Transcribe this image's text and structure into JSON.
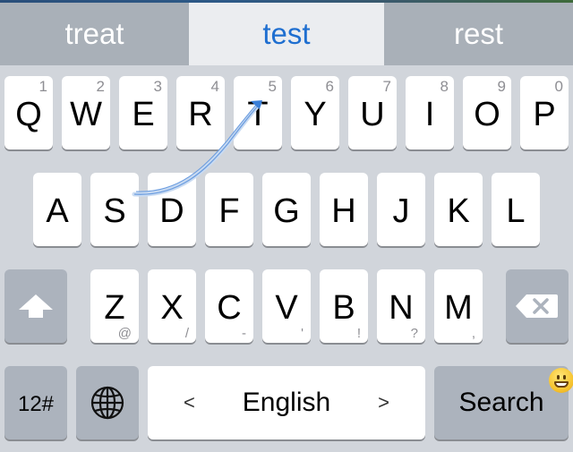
{
  "suggestions": [
    "treat",
    "test",
    "rest"
  ],
  "selected_suggestion": "test",
  "colors": {
    "keyboard_bg": "#d1d5db",
    "suggestion_bar": "#a9b0b8",
    "suggestion_selected_bg": "#ebedf0",
    "suggestion_selected_text": "#1f6fd0",
    "key_light": "#ffffff",
    "key_dark": "#acb3bd",
    "swipe_trail": "#5a8fd6"
  },
  "rows": {
    "row1": [
      {
        "letter": "Q",
        "hint": "1"
      },
      {
        "letter": "W",
        "hint": "2"
      },
      {
        "letter": "E",
        "hint": "3"
      },
      {
        "letter": "R",
        "hint": "4"
      },
      {
        "letter": "T",
        "hint": "5"
      },
      {
        "letter": "Y",
        "hint": "6"
      },
      {
        "letter": "U",
        "hint": "7"
      },
      {
        "letter": "I",
        "hint": "8"
      },
      {
        "letter": "O",
        "hint": "9"
      },
      {
        "letter": "P",
        "hint": "0"
      }
    ],
    "row2": [
      {
        "letter": "A"
      },
      {
        "letter": "S"
      },
      {
        "letter": "D"
      },
      {
        "letter": "F"
      },
      {
        "letter": "G"
      },
      {
        "letter": "H"
      },
      {
        "letter": "J"
      },
      {
        "letter": "K"
      },
      {
        "letter": "L"
      }
    ],
    "row3": [
      {
        "letter": "Z",
        "hint": "@"
      },
      {
        "letter": "X",
        "hint": "/"
      },
      {
        "letter": "C",
        "hint": "-"
      },
      {
        "letter": "V",
        "hint": "'"
      },
      {
        "letter": "B",
        "hint": "!"
      },
      {
        "letter": "N",
        "hint": "?"
      },
      {
        "letter": "M",
        "hint": ","
      }
    ]
  },
  "bottom_row": {
    "numbers_label": "12#",
    "globe_icon": "globe-icon",
    "space_label": "English",
    "space_prev": "<",
    "space_next": ">",
    "action_label": "Search",
    "emoji_icon": "grinning-face-icon"
  },
  "icons": {
    "shift": "shift-arrow-icon",
    "backspace": "backspace-icon"
  },
  "swipe_trail": {
    "from_key": "S",
    "to_key": "T"
  }
}
